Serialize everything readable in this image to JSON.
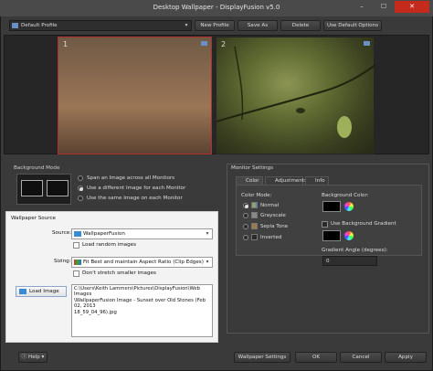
{
  "window": {
    "title": "Desktop Wallpaper - DisplayFusion v5.0",
    "min": "–",
    "max": "☐",
    "close": "✕"
  },
  "toolbar": {
    "profile": "Default Profile",
    "new_profile": "New Profile",
    "save_as": "Save As",
    "delete": "Delete",
    "use_default_options": "Use Default Options"
  },
  "preview": {
    "monitor1": "1",
    "monitor2": "2"
  },
  "background_mode": {
    "label": "Background Mode",
    "options": [
      "Span an Image across all Monitors",
      "Use a different Image for each Monitor",
      "Use the same Image on each Monitor"
    ],
    "selected": 1
  },
  "monitor_settings": {
    "label": "Monitor Settings",
    "tabs": [
      "Color",
      "Adjustments",
      "Info"
    ],
    "color_mode_label": "Color Mode:",
    "color_modes": [
      "Normal",
      "Grayscale",
      "Sepia Tone",
      "Inverted"
    ],
    "background_color_label": "Background Color:",
    "use_gradient": "Use Background Gradient",
    "gradient_angle_label": "Gradient Angle (degrees):",
    "gradient_angle": "0"
  },
  "wallpaper_source": {
    "label": "Wallpaper Source",
    "source_label": "Source:",
    "source_value": "WallpaperFusion",
    "load_random": "Load random images",
    "sizing_label": "Sizing:",
    "sizing_value": "Fit Best and maintain Aspect Ratio (Clip Edges)",
    "dont_stretch": "Don't stretch smaller images",
    "load_image": "Load Image",
    "path": "C:\\Users\\Keith Lammers\\Pictures\\DisplayFusion\\Web Images\n\\WallpaperFusion Image - Sunset over Old Stones (Feb 02, 2013\n18_59_04_96).jpg"
  },
  "bottom": {
    "help": "Help",
    "wallpaper_settings": "Wallpaper Settings",
    "ok": "OK",
    "cancel": "Cancel",
    "apply": "Apply"
  }
}
